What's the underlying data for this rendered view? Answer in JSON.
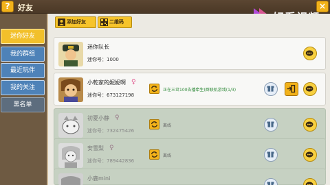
{
  "topbar": {
    "help_label": "?",
    "title": "好友",
    "close_label": "×",
    "watermark_text": "好看视频"
  },
  "sidebar": {
    "items": [
      {
        "label": "迷你好友"
      },
      {
        "label": "我的群组"
      },
      {
        "label": "最近玩伴"
      },
      {
        "label": "我的关注"
      },
      {
        "label": "黑名单"
      }
    ]
  },
  "toolbar": {
    "add_friend_label": "添加好友",
    "qrcode_label": "二维码"
  },
  "friends": [
    {
      "name": "迷你队长",
      "id_text": "迷你号：1000",
      "status": ""
    },
    {
      "name": "小乾家的妮妮啊",
      "id_text": "迷你号：673127198",
      "gender": "♀",
      "status": "正在三岔100告播牵生(群联机游戏(1/3)"
    },
    {
      "name": "初夏小静",
      "id_text": "迷你号：732475426",
      "gender": "♀",
      "status": "离线"
    },
    {
      "name": "安雪梨",
      "id_text": "迷你号：789442836",
      "gender": "♀",
      "status": "离线"
    },
    {
      "name": "小鹿mini",
      "id_text": "",
      "status": ""
    }
  ],
  "colors": {
    "accent_yellow": "#f2c02b",
    "sidebar_blue": "#4e82b8",
    "online_green": "#2f8a3a"
  }
}
